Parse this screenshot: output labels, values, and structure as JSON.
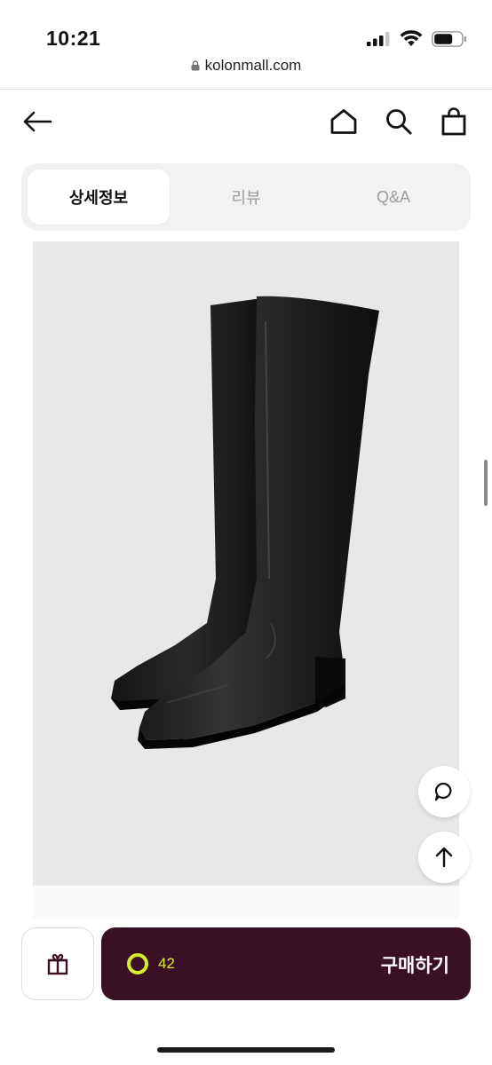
{
  "status_bar": {
    "time": "10:21"
  },
  "browser": {
    "url": "kolonmall.com"
  },
  "nav": {
    "back_icon": "arrow-left-icon",
    "home_icon": "home-icon",
    "search_icon": "search-icon",
    "cart_icon": "shopping-bag-icon"
  },
  "tabs": [
    {
      "label": "상세정보",
      "active": true
    },
    {
      "label": "리뷰",
      "active": false
    },
    {
      "label": "Q&A",
      "active": false
    }
  ],
  "product_image": {
    "subject": "black knee-high leather boots",
    "background_color": "#e8e8e8"
  },
  "floating_buttons": {
    "chat_icon": "chat-bubble-icon",
    "scroll_top_icon": "arrow-up-icon"
  },
  "bottom_bar": {
    "gift_icon": "gift-icon",
    "count": "42",
    "buy_label": "구매하기",
    "colors": {
      "buy_background": "#3a1124",
      "accent": "#d7ec2e"
    }
  }
}
